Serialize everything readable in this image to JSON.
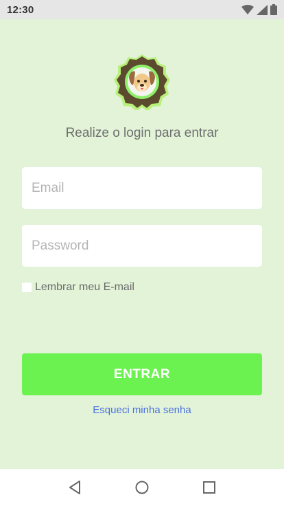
{
  "status_bar": {
    "time": "12:30",
    "icons": [
      "wifi-icon",
      "signal-icon",
      "battery-icon"
    ]
  },
  "login": {
    "logo": "dog-logo-icon",
    "subtitle": "Realize o login para entrar",
    "email_placeholder": "Email",
    "email_value": "",
    "password_placeholder": "Password",
    "password_value": "",
    "remember_label": "Lembrar meu E-mail",
    "remember_checked": false,
    "submit_label": "ENTRAR",
    "forgot_label": "Esqueci minha senha"
  },
  "nav_bar": {
    "buttons": [
      "back-icon",
      "home-icon",
      "recents-icon"
    ]
  },
  "colors": {
    "background": "#e2f3d8",
    "button": "#6cf250",
    "link": "#4a6fe0",
    "logo_ring": "#5c4a2e"
  }
}
